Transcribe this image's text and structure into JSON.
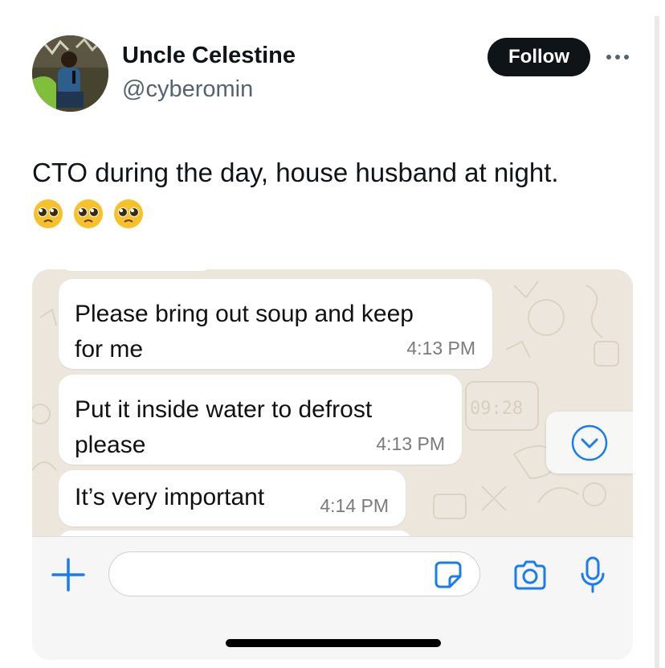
{
  "author": {
    "name": "Uncle Celestine",
    "handle": "@cyberomin"
  },
  "follow_button": {
    "label": "Follow"
  },
  "tweet": {
    "text": "CTO during the day, house husband at night.",
    "emojis": [
      "pleading-face",
      "pleading-face",
      "pleading-face"
    ]
  },
  "chat": {
    "messages": [
      {
        "text": "Please bring out soup and keep\nfor me",
        "time": "4:13 PM"
      },
      {
        "text": "Put it inside water to defrost\nplease",
        "time": "4:13 PM"
      },
      {
        "text": "It’s very important",
        "time": "4:14 PM"
      }
    ],
    "wallpaper_clock": "09:28"
  },
  "icons": {
    "more": "ellipsis-icon",
    "scroll_down": "chevron-down-circle-icon",
    "attach": "plus-icon",
    "sticker": "sticker-icon",
    "camera": "camera-icon",
    "mic": "microphone-icon"
  },
  "colors": {
    "accent_blue": "#1a7cf0",
    "follow_bg": "#0f1419",
    "chat_wallpaper": "#ece6dc"
  }
}
